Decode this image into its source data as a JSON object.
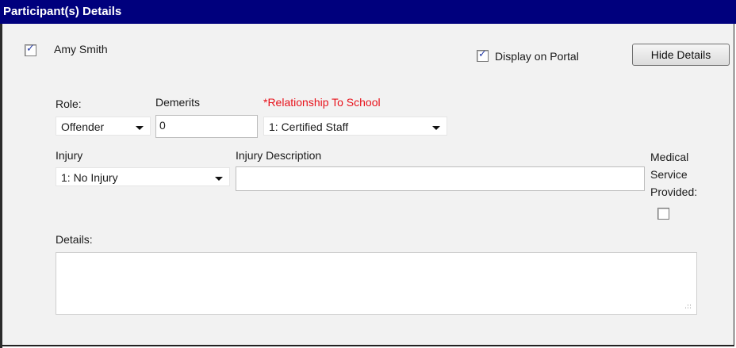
{
  "header": {
    "title": "Participant(s) Details"
  },
  "participant": {
    "name": "Amy Smith",
    "selected": true
  },
  "display_on_portal": {
    "label": "Display on Portal",
    "checked": true
  },
  "hide_details_button": {
    "label": "Hide Details"
  },
  "role": {
    "label": "Role:",
    "value": "Offender"
  },
  "demerits": {
    "label": "Demerits",
    "value": "0"
  },
  "relationship": {
    "label": "*Relationship To School",
    "value": "1: Certified Staff",
    "required_color": "#e8121b"
  },
  "injury": {
    "label": "Injury",
    "value": "1: No Injury"
  },
  "injury_description": {
    "label": "Injury Description",
    "value": ""
  },
  "medical_service": {
    "label_line1": "Medical",
    "label_line2": "Service",
    "label_line3": "Provided:",
    "checked": false
  },
  "details": {
    "label": "Details:",
    "value": ""
  },
  "colors": {
    "header_bg": "#00007d",
    "header_text": "#ffffff",
    "panel_bg": "#f2f2f2"
  },
  "icons": {
    "checkbox_check": "checkmark-icon",
    "dropdown": "chevron-down-icon",
    "resize": "resize-grip-icon"
  }
}
